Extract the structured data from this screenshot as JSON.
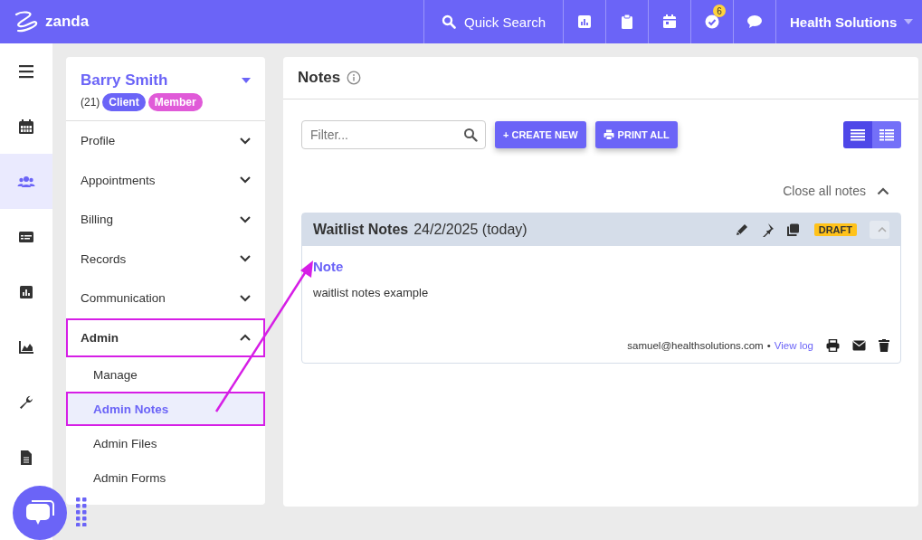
{
  "topbar": {
    "logo": "zanda",
    "search": "Quick Search",
    "tools": [
      {
        "kind": "chart"
      },
      {
        "kind": "clipboard"
      },
      {
        "kind": "calendar"
      },
      {
        "kind": "tasks",
        "badge": "6"
      },
      {
        "kind": "chat"
      }
    ],
    "org": "Health Solutions"
  },
  "rail": [
    {
      "kind": "menu",
      "selected": false
    },
    {
      "kind": "calendar",
      "selected": false
    },
    {
      "kind": "people",
      "selected": true
    },
    {
      "kind": "card",
      "selected": false
    },
    {
      "kind": "chart",
      "selected": false
    },
    {
      "kind": "area",
      "selected": false
    },
    {
      "kind": "wrench",
      "selected": false
    },
    {
      "kind": "document",
      "selected": false
    }
  ],
  "client": {
    "name": "Barry Smith",
    "count": "(21)",
    "tags": [
      {
        "label": "Client",
        "color": "#6b64f7"
      },
      {
        "label": "Member",
        "color": "#e05ad8"
      }
    ]
  },
  "nav": [
    {
      "label": "Profile",
      "expanded": false,
      "highlighted": false
    },
    {
      "label": "Appointments",
      "expanded": false,
      "highlighted": false
    },
    {
      "label": "Billing",
      "expanded": false,
      "highlighted": false
    },
    {
      "label": "Records",
      "expanded": false,
      "highlighted": false
    },
    {
      "label": "Communication",
      "expanded": false,
      "highlighted": false
    },
    {
      "label": "Admin",
      "expanded": true,
      "highlighted": true,
      "children": [
        {
          "label": "Manage",
          "selected": false,
          "highlighted": false
        },
        {
          "label": "Admin Notes",
          "selected": true,
          "highlighted": true
        },
        {
          "label": "Admin Files",
          "selected": false,
          "highlighted": false
        },
        {
          "label": "Admin Forms",
          "selected": false,
          "highlighted": false
        }
      ]
    }
  ],
  "main": {
    "title": "Notes",
    "filter": {
      "placeholder": "Filter..."
    },
    "create": "+ CREATE NEW",
    "print": "PRINT ALL",
    "views": [
      {
        "kind": "list",
        "selected": true
      },
      {
        "kind": "grid",
        "selected": false
      }
    ],
    "close_all": "Close all notes",
    "note": {
      "title": "Waitlist Notes",
      "date": "24/2/2025 (today)",
      "status": "DRAFT",
      "heading": "Note",
      "body": "waitlist notes example",
      "author": "samuel@healthsolutions.com",
      "separator": "•",
      "log": "View log"
    }
  }
}
